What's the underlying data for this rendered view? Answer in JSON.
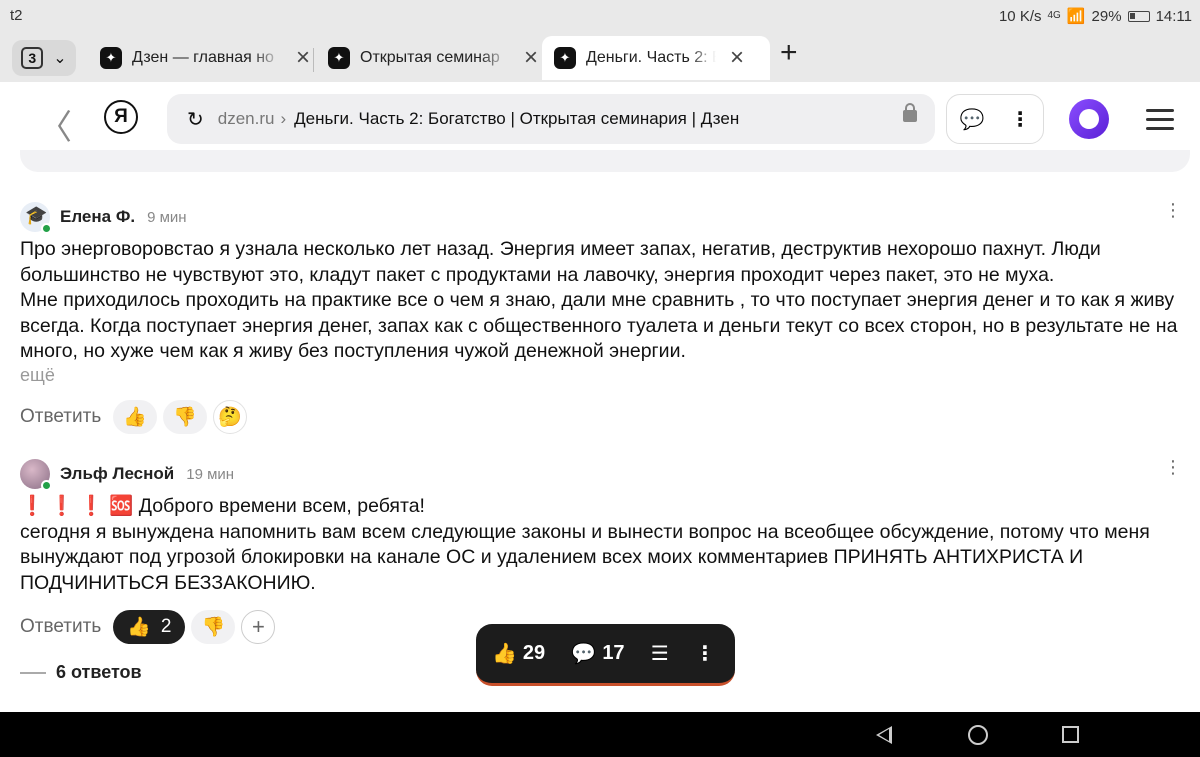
{
  "status_bar": {
    "carrier": "t2",
    "speed": "10 K/s",
    "network": "4G",
    "battery": "29%",
    "time": "14:11"
  },
  "tabs": {
    "count": "3",
    "items": [
      {
        "title": "Дзен — главная но"
      },
      {
        "title": "Открытая семинар"
      },
      {
        "title": "Деньги. Часть 2: Б"
      }
    ]
  },
  "address_bar": {
    "domain": "dzen.ru",
    "page_title": "Деньги. Часть 2: Богатство | Открытая семинария | Дзен",
    "yandex_letter": "Я"
  },
  "comments": [
    {
      "author": "Елена Ф.",
      "time": "9 мин",
      "paragraphs": [
        "Про энерговоровстао я узнала несколько лет назад. Энергия имеет запах, негатив, деструктив нехорошо пахнут. Люди большинство не чувствуют это, кладут пакет с продуктами на лавочку, энергия проходит через пакет, это не муха.",
        "Мне приходилось проходить на практике все о чем я знаю, дали мне сравнить , то что поступает энергия денег и то как я живу всегда. Когда поступает энергия денег, запах как с общественного туалета и деньги текут со всех сторон, но в результате не на много, но хуже чем как я живу без поступления чужой денежной энергии."
      ],
      "more_label": "ещё",
      "reply_label": "Ответить"
    },
    {
      "author": "Эльф Лесной",
      "time": "19 мин",
      "paragraphs": [
        "❗ ❗ ❗ 🆘 Доброго времени всем, ребята!",
        "сегодня я вынуждена напомнить вам всем следующие законы и вынести вопрос на всеобщее обсуждение, потому что меня вынуждают под угрозой блокировки на канале ОС и удалением всех моих комментариев ПРИНЯТЬ АНТИХРИСТА И ПОДЧИНИТЬСЯ БЕЗЗАКОНИЮ."
      ],
      "reply_label": "Ответить",
      "likes": "2",
      "answers_label": "6 ответов"
    }
  ],
  "floating_bar": {
    "likes": "29",
    "comments": "17"
  }
}
